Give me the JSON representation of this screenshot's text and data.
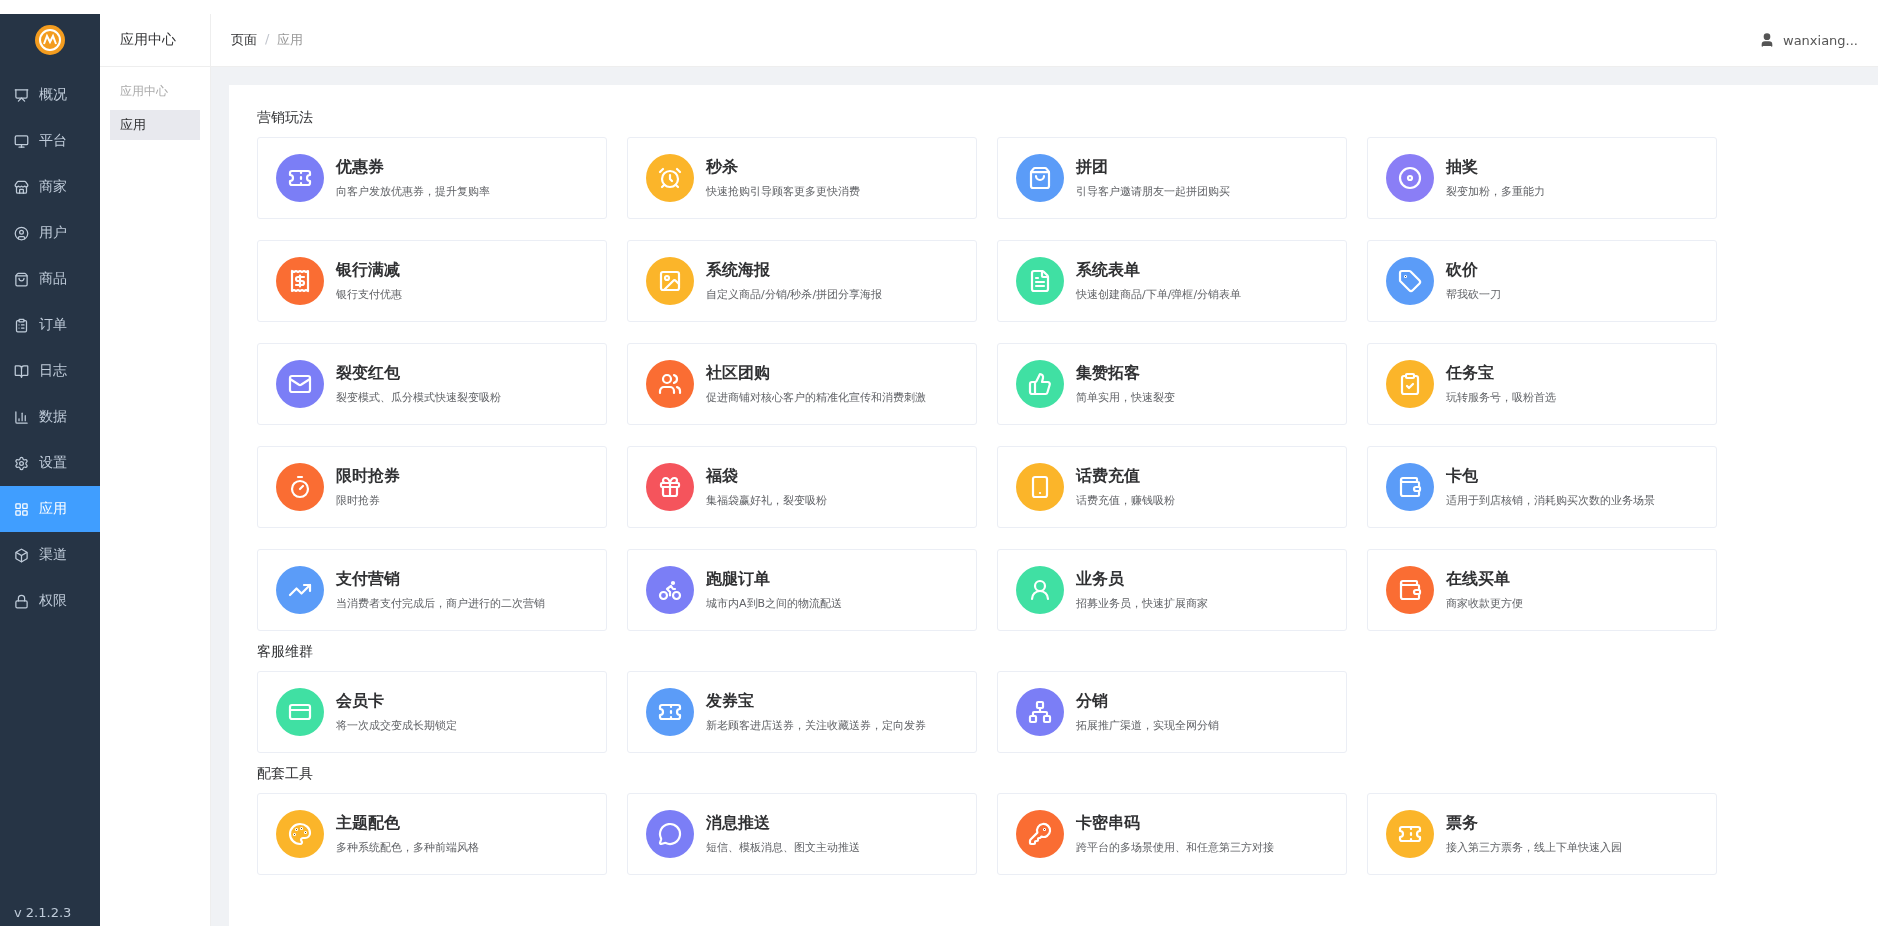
{
  "sidebar": {
    "items": [
      {
        "label": "概况",
        "selected": false
      },
      {
        "label": "平台",
        "selected": false
      },
      {
        "label": "商家",
        "selected": false
      },
      {
        "label": "用户",
        "selected": false
      },
      {
        "label": "商品",
        "selected": false
      },
      {
        "label": "订单",
        "selected": false
      },
      {
        "label": "日志",
        "selected": false
      },
      {
        "label": "数据",
        "selected": false
      },
      {
        "label": "设置",
        "selected": false
      },
      {
        "label": "应用",
        "selected": true
      },
      {
        "label": "渠道",
        "selected": false
      },
      {
        "label": "权限",
        "selected": false
      }
    ],
    "version": "v 2.1.2.3"
  },
  "subnav": {
    "title": "应用中心",
    "group": "应用中心",
    "items": [
      {
        "label": "应用",
        "selected": true
      }
    ]
  },
  "breadcrumb": {
    "items": [
      "页面",
      "应用"
    ],
    "separator": "/"
  },
  "user": {
    "name": "wanxiang..."
  },
  "sections": [
    {
      "title": "营销玩法",
      "apps": [
        {
          "name": "优惠券",
          "desc": "向客户发放优惠券，提升复购率",
          "color": "#7b7ef6"
        },
        {
          "name": "秒杀",
          "desc": "快速抢购引导顾客更多更快消费",
          "color": "#fbb52a"
        },
        {
          "name": "拼团",
          "desc": "引导客户邀请朋友一起拼团购买",
          "color": "#5b9cf8"
        },
        {
          "name": "抽奖",
          "desc": "裂变加粉，多重能力",
          "color": "#8a7ef6"
        },
        {
          "name": "银行满减",
          "desc": "银行支付优惠",
          "color": "#fa6d33"
        },
        {
          "name": "系统海报",
          "desc": "自定义商品/分销/秒杀/拼团分享海报",
          "color": "#fbb52a"
        },
        {
          "name": "系统表单",
          "desc": "快速创建商品/下单/弹框/分销表单",
          "color": "#40e0a3"
        },
        {
          "name": "砍价",
          "desc": "帮我砍一刀",
          "color": "#5b9cf8"
        },
        {
          "name": "裂变红包",
          "desc": "裂变模式、瓜分模式快速裂变吸粉",
          "color": "#7b7ef6"
        },
        {
          "name": "社区团购",
          "desc": "促进商铺对核心客户的精准化宣传和消费刺激",
          "color": "#fa6d33"
        },
        {
          "name": "集赞拓客",
          "desc": "简单实用，快速裂变",
          "color": "#40e0a3"
        },
        {
          "name": "任务宝",
          "desc": "玩转服务号，吸粉首选",
          "color": "#fbb52a"
        },
        {
          "name": "限时抢券",
          "desc": "限时抢券",
          "color": "#fa6d33"
        },
        {
          "name": "福袋",
          "desc": "集福袋赢好礼，裂变吸粉",
          "color": "#f5545c"
        },
        {
          "name": "话费充值",
          "desc": "话费充值，赚钱吸粉",
          "color": "#fbb52a"
        },
        {
          "name": "卡包",
          "desc": "适用于到店核销，消耗购买次数的业务场景",
          "color": "#5b9cf8"
        },
        {
          "name": "支付营销",
          "desc": "当消费者支付完成后，商户进行的二次营销",
          "color": "#5b9cf8"
        },
        {
          "name": "跑腿订单",
          "desc": "城市内A到B之间的物流配送",
          "color": "#7b7ef6"
        },
        {
          "name": "业务员",
          "desc": "招募业务员，快速扩展商家",
          "color": "#40e0a3"
        },
        {
          "name": "在线买单",
          "desc": "商家收款更方便",
          "color": "#fa6d33"
        }
      ]
    },
    {
      "title": "客服维群",
      "apps": [
        {
          "name": "会员卡",
          "desc": "将一次成交变成长期锁定",
          "color": "#40e0a3"
        },
        {
          "name": "发券宝",
          "desc": "新老顾客进店送券，关注收藏送券，定向发券",
          "color": "#5b9cf8"
        },
        {
          "name": "分销",
          "desc": "拓展推广渠道，实现全网分销",
          "color": "#7b7ef6"
        }
      ]
    },
    {
      "title": "配套工具",
      "apps": [
        {
          "name": "主题配色",
          "desc": "多种系统配色，多种前端风格",
          "color": "#fbb52a"
        },
        {
          "name": "消息推送",
          "desc": "短信、模板消息、图文主动推送",
          "color": "#7b7ef6"
        },
        {
          "name": "卡密串码",
          "desc": "跨平台的多场景使用、和任意第三方对接",
          "color": "#fa6d33"
        },
        {
          "name": "票务",
          "desc": "接入第三方票务，线上下单快速入园",
          "color": "#fbb52a"
        }
      ]
    }
  ]
}
